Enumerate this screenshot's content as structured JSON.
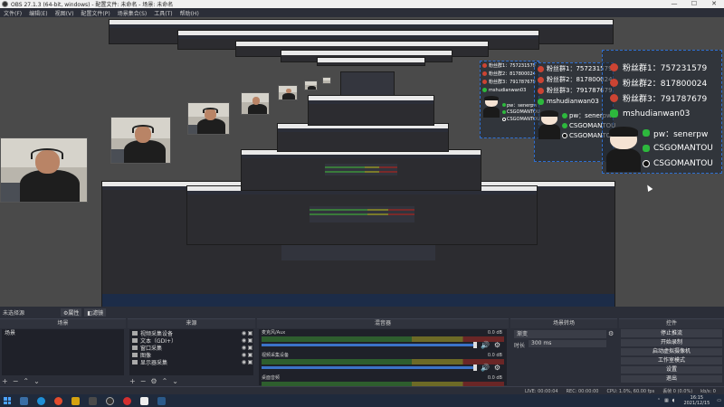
{
  "window": {
    "title": "OBS 27.1.3 (64-bit, windows) - 配置文件: 未命名 - 场景: 未命名",
    "controls": [
      "—",
      "☐",
      "✕"
    ]
  },
  "menu": [
    "文件(F)",
    "编辑(E)",
    "视图(V)",
    "配置文件(P)",
    "场景集合(S)",
    "工具(T)",
    "帮助(H)"
  ],
  "overlay": {
    "fans": [
      {
        "label": "粉丝群1：757231579"
      },
      {
        "label": "粉丝群2：817800024"
      },
      {
        "label": "粉丝群3：791787679"
      }
    ],
    "wechat": "mshudianwan03",
    "pw": "pw：senerpw",
    "weibo": "CSGOMANTOU",
    "douyin": "CSGOMANTOU"
  },
  "no_source": "未选择源",
  "props_btn": "属性",
  "filter_btn": "滤镜",
  "scenes": {
    "title": "场景",
    "items": [
      "场景"
    ]
  },
  "sources": {
    "title": "来源",
    "items": [
      {
        "label": "视频采集设备"
      },
      {
        "label": "文本（GDI+）"
      },
      {
        "label": "窗口采集"
      },
      {
        "label": "图像"
      },
      {
        "label": "显示器采集"
      }
    ]
  },
  "mixer": {
    "title": "混音器",
    "channels": [
      {
        "name": "麦克风/Aux",
        "db": "0.0 dB"
      },
      {
        "name": "视频采集设备",
        "db": "0.0 dB"
      },
      {
        "name": "桌面音频",
        "db": "0.0 dB"
      }
    ]
  },
  "transitions": {
    "title": "场景转场",
    "selected": "渐变",
    "duration_label": "时长",
    "duration": "300 ms"
  },
  "controls": {
    "title": "控件",
    "stop_stream": "停止推流",
    "buttons": [
      "开始录制",
      "启动虚拟摄像机",
      "工作室模式",
      "设置",
      "退出"
    ]
  },
  "status": {
    "live": "LIVE: 00:00:04",
    "rec": "REC: 00:00:00",
    "cpu": "CPU: 1.0%, 60.00 fps",
    "dropped": "丢帧 0 (0.0%)",
    "kbps": "kb/s: 0"
  },
  "taskbar": {
    "time": "16:15",
    "date": "2021/12/15"
  },
  "colors": {
    "accent": "#3b73c8",
    "bg": "#2b2e38",
    "panel": "#1f2129",
    "wechat": "#2db83d",
    "overlay_border": "#2f6fd0"
  }
}
